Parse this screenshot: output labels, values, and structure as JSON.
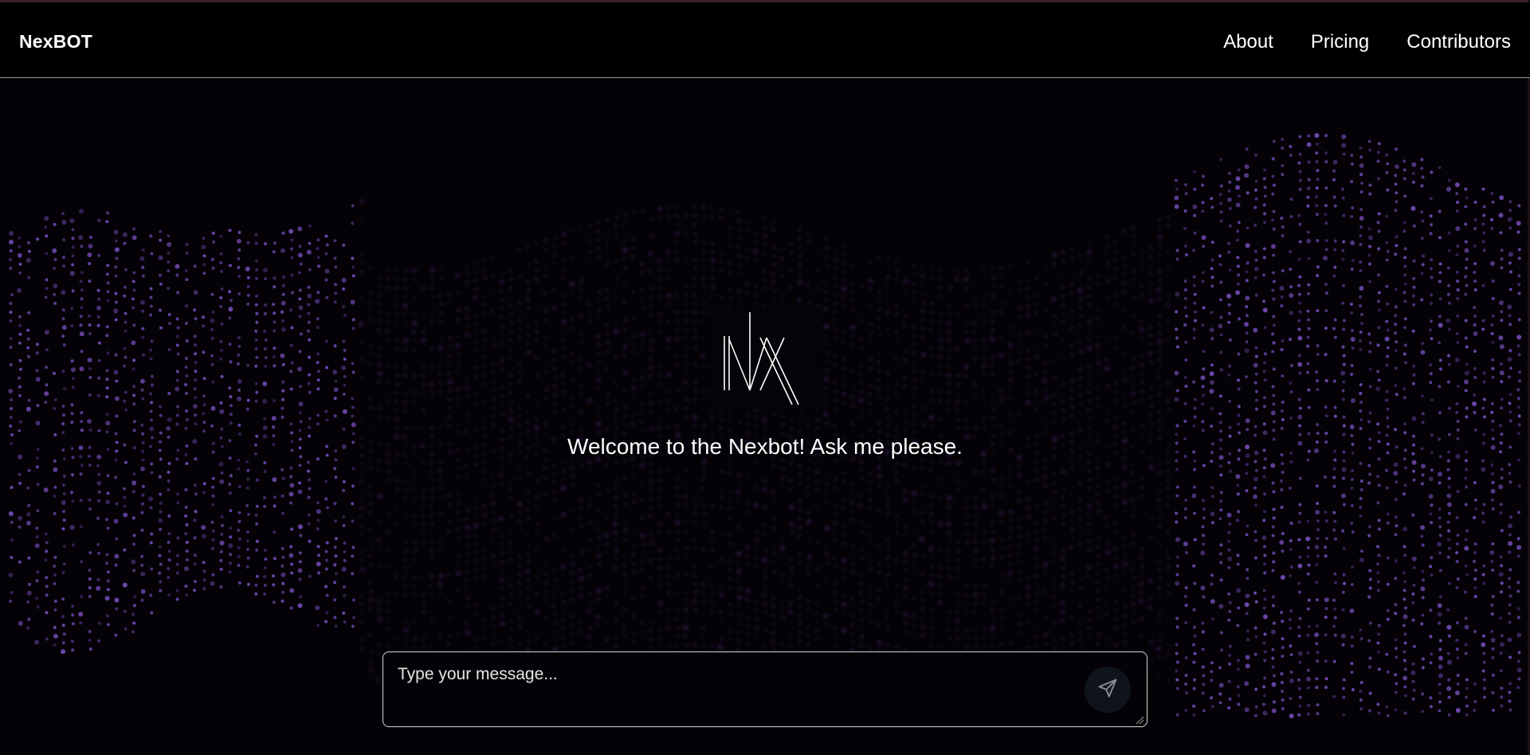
{
  "app": {
    "brand": "NexBOT"
  },
  "nav": {
    "items": [
      {
        "label": "About"
      },
      {
        "label": "Pricing"
      },
      {
        "label": "Contributors"
      }
    ]
  },
  "hero": {
    "logo_icon": "nx-logo-icon",
    "welcome_text": "Welcome to the Nexbot! Ask me please."
  },
  "chat": {
    "placeholder": "Type your message...",
    "value": "",
    "send_icon": "send-icon"
  },
  "colors": {
    "background": "#040206",
    "dot_accent": "#7a4fc0",
    "text": "#ffffff"
  }
}
